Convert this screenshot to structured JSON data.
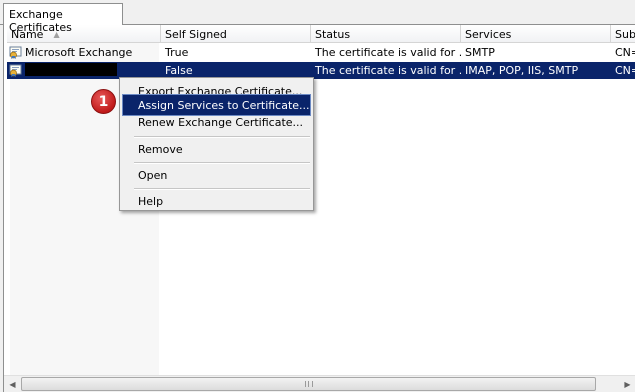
{
  "tab": {
    "label": "Exchange Certificates"
  },
  "columns": [
    {
      "label": "Name",
      "width": 154
    },
    {
      "label": "Self Signed",
      "width": 150
    },
    {
      "label": "Status",
      "width": 150
    },
    {
      "label": "Services",
      "width": 150
    },
    {
      "label": "Sub",
      "width": 36
    }
  ],
  "sort_arrow": "▲",
  "rows": [
    {
      "name": "Microsoft Exchange",
      "self_signed": "True",
      "status": "The certificate is valid for ...",
      "services": "SMTP",
      "subject": "CN="
    },
    {
      "name": "",
      "self_signed": "False",
      "status": "The certificate is valid for ...",
      "services": "IMAP, POP, IIS, SMTP",
      "subject": "CN="
    }
  ],
  "context_menu": {
    "items": [
      {
        "label": "Export Exchange Certificate..."
      },
      {
        "label": "Assign Services to Certificate..."
      },
      {
        "label": "Renew Exchange Certificate..."
      },
      {
        "label": "Remove"
      },
      {
        "label": "Open"
      },
      {
        "label": "Help"
      }
    ]
  },
  "callout": {
    "number": "1"
  },
  "scrollbar": {
    "left_arrow": "◀",
    "right_arrow": "▶"
  },
  "colors": {
    "selection": "#0a246a",
    "callout": "#c01a1a"
  },
  "icons": {
    "certificate": "certificate-icon"
  }
}
